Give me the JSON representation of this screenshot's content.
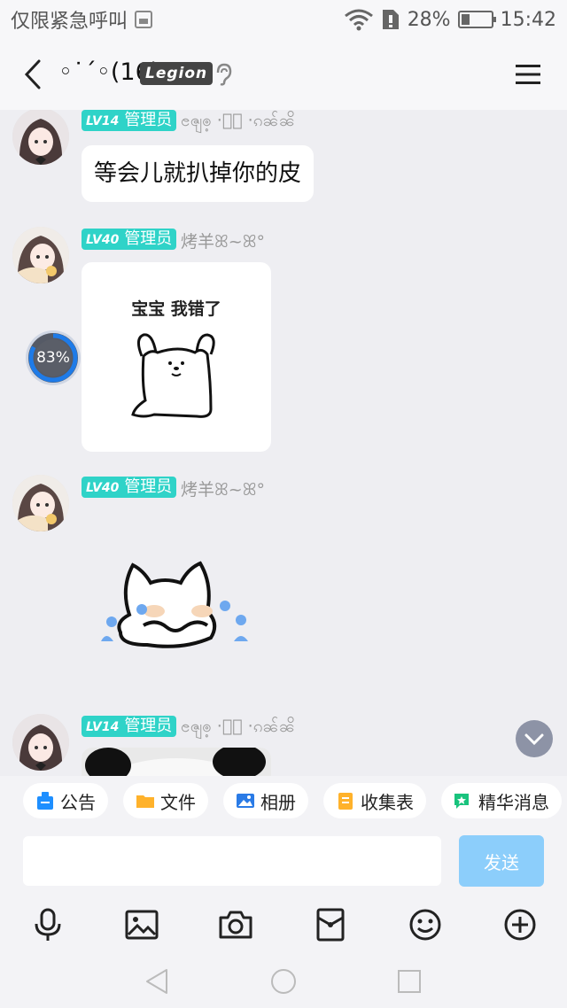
{
  "status_bar": {
    "left_text": "仅限紧急呼叫",
    "battery": "28%",
    "time": "15:42",
    "battery_level": 0.28
  },
  "header": {
    "title": "◦˙ˊ◦(16)",
    "badge": "Legion"
  },
  "messages": [
    {
      "level": "LV14",
      "role": "管理员",
      "nickname": "ၔၛၜ့ ·့͙ ·ၵၼ်ၼိ",
      "text": "等会儿就扒掉你的皮"
    },
    {
      "level": "LV40",
      "role": "管理员",
      "nickname": "烤羊ꕤ~ꕤ°",
      "sticker_caption": "宝宝 我错了"
    },
    {
      "level": "LV40",
      "role": "管理员",
      "nickname": "烤羊ꕤ~ꕤ°"
    },
    {
      "level": "LV14",
      "role": "管理员",
      "nickname": "ၔၛၜ့ ·့͙ ·ၵၼ်ၼိ"
    }
  ],
  "upload_progress": "83%",
  "upload_fraction": 0.83,
  "shortcuts": [
    {
      "label": "公告",
      "icon": "announcement-icon",
      "color": "#1e8fff"
    },
    {
      "label": "文件",
      "icon": "folder-icon",
      "color": "#ffb22b"
    },
    {
      "label": "相册",
      "icon": "album-icon",
      "color": "#2a7be6"
    },
    {
      "label": "收集表",
      "icon": "form-icon",
      "color": "#ffb22b"
    },
    {
      "label": "精华消息",
      "icon": "highlight-icon",
      "color": "#19c37d"
    }
  ],
  "composer": {
    "placeholder": "",
    "send_label": "发送"
  },
  "colors": {
    "admin_badge": "#2fd3c8",
    "send_button": "#8ccefb",
    "progress_ring": "#1e7be8"
  },
  "toolbar_icons": [
    "microphone-icon",
    "image-icon",
    "camera-icon",
    "red-packet-icon",
    "emoji-icon",
    "plus-icon"
  ],
  "nav_icons": [
    "back-triangle-icon",
    "home-circle-icon",
    "recents-square-icon"
  ]
}
